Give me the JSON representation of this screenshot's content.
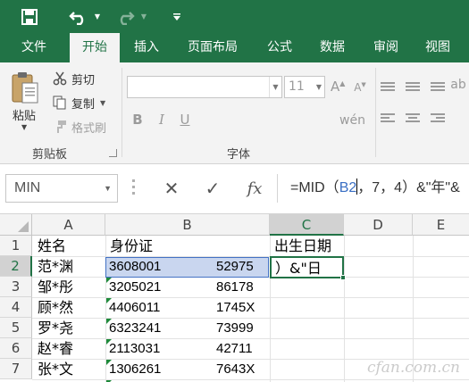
{
  "quick_access": {
    "save_icon": "save-icon",
    "undo_icon": "undo-icon",
    "redo_icon": "redo-icon",
    "customize_icon": "customize-toolbar-icon"
  },
  "tabs": [
    "文件",
    "开始",
    "插入",
    "页面布局",
    "公式",
    "数据",
    "审阅",
    "视图"
  ],
  "active_tab": "开始",
  "clipboard": {
    "paste_label": "粘贴",
    "cut_label": "剪切",
    "copy_label": "复制",
    "format_painter_label": "格式刷",
    "group_label": "剪贴板"
  },
  "font": {
    "font_name": "",
    "font_size": "11",
    "bold": "B",
    "italic": "I",
    "underline": "U",
    "grow": "A",
    "shrink": "A",
    "group_label": "字体"
  },
  "formula_bar": {
    "name_box": "MIN",
    "cancel": "✕",
    "enter": "✓",
    "fx": "fx",
    "formula_prefix": "=MID（",
    "formula_ref": "B2",
    "formula_suffix": "，7，4）&\"年\"&"
  },
  "sheet": {
    "columns": [
      "A",
      "B",
      "C",
      "D",
      "E"
    ],
    "rows": [
      "1",
      "2",
      "3",
      "4",
      "5",
      "6",
      "7"
    ],
    "header_row": {
      "a": "姓名",
      "b": "身份证",
      "c": "出生日期"
    },
    "data_rows": [
      {
        "name": "范*渊",
        "id_left": "3608001",
        "id_right": "52975"
      },
      {
        "name": "邹*彤",
        "id_left": "3205021",
        "id_right": "86178"
      },
      {
        "name": "顾*然",
        "id_left": "4406011",
        "id_right": "1745X"
      },
      {
        "name": "罗*尧",
        "id_left": "6323241",
        "id_right": "73999"
      },
      {
        "name": "赵*睿",
        "id_left": "2113031",
        "id_right": "42711"
      },
      {
        "name": "张*文",
        "id_left": "1306261",
        "id_right": "7643X"
      }
    ],
    "active_cell_text": "）&\"日",
    "selected_column": "C",
    "selected_row": "2"
  },
  "watermark": "cfan.com.cn",
  "colors": {
    "accent": "#217346",
    "ref_highlight": "#c9d6ef",
    "ref_border": "#4472c4"
  }
}
